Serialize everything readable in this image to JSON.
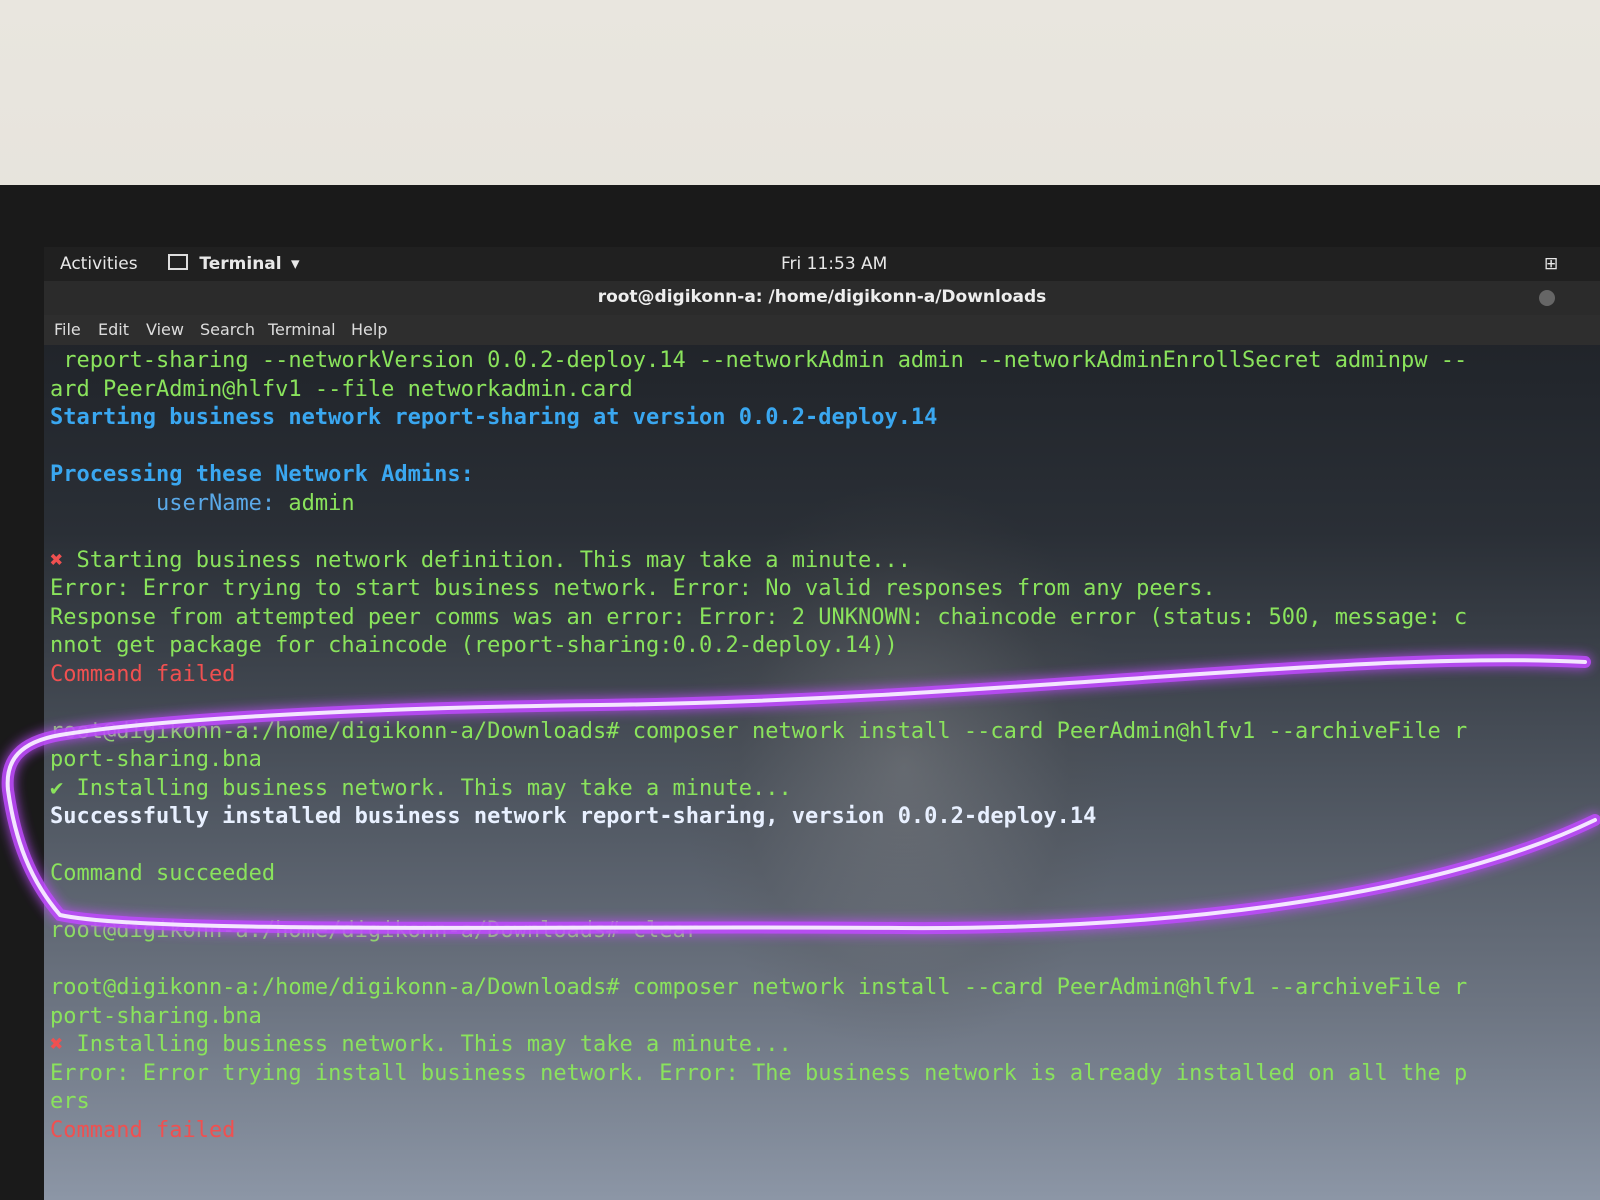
{
  "topbar": {
    "activities": "Activities",
    "app_menu": "Terminal",
    "clock": "Fri 11:53 AM"
  },
  "window": {
    "title": "root@digikonn-a: /home/digikonn-a/Downloads"
  },
  "menu": [
    "File",
    "Edit",
    "View",
    "Search",
    "Terminal",
    "Help"
  ],
  "terminal": {
    "lines": [
      {
        "text": " report-sharing --networkVersion 0.0.2-deploy.14 --networkAdmin admin --networkAdminEnrollSecret adminpw --",
        "cls": "g"
      },
      {
        "text": "ard PeerAdmin@hlfv1 --file networkadmin.card",
        "cls": "g"
      },
      {
        "text": "Starting business network report-sharing at version 0.0.2-deploy.14",
        "cls": "b"
      },
      {
        "text": "",
        "cls": "g"
      },
      {
        "text": "Processing these Network Admins:",
        "cls": "b"
      },
      {
        "text": "        userName: admin",
        "cls": "g",
        "label": "userName:"
      },
      {
        "text": "",
        "cls": "g"
      },
      {
        "text": "✖ Starting business network definition. This may take a minute...",
        "cls": "g",
        "mark": "r"
      },
      {
        "text": "Error: Error trying to start business network. Error: No valid responses from any peers.",
        "cls": "g"
      },
      {
        "text": "Response from attempted peer comms was an error: Error: 2 UNKNOWN: chaincode error (status: 500, message: c",
        "cls": "g"
      },
      {
        "text": "nnot get package for chaincode (report-sharing:0.0.2-deploy.14))",
        "cls": "g"
      },
      {
        "text": "Command failed",
        "cls": "r"
      },
      {
        "text": "",
        "cls": "g"
      },
      {
        "text": "root@digikonn-a:/home/digikonn-a/Downloads# composer network install --card PeerAdmin@hlfv1 --archiveFile r",
        "cls": "g"
      },
      {
        "text": "port-sharing.bna",
        "cls": "g"
      },
      {
        "text": "✔ Installing business network. This may take a minute...",
        "cls": "g"
      },
      {
        "text": "Successfully installed business network report-sharing, version 0.0.2-deploy.14",
        "cls": "w"
      },
      {
        "text": "",
        "cls": "g"
      },
      {
        "text": "Command succeeded",
        "cls": "g"
      },
      {
        "text": "",
        "cls": "g"
      },
      {
        "text": "root@digikonn-a:/home/digikonn-a/Downloads# clear",
        "cls": "g"
      },
      {
        "text": "",
        "cls": "g"
      },
      {
        "text": "root@digikonn-a:/home/digikonn-a/Downloads# composer network install --card PeerAdmin@hlfv1 --archiveFile r",
        "cls": "g"
      },
      {
        "text": "port-sharing.bna",
        "cls": "g"
      },
      {
        "text": "✖ Installing business network. This may take a minute...",
        "cls": "g",
        "mark": "r"
      },
      {
        "text": "Error: Error trying install business network. Error: The business network is already installed on all the p",
        "cls": "g"
      },
      {
        "text": "ers",
        "cls": "g"
      },
      {
        "text": "Command failed",
        "cls": "r"
      }
    ]
  },
  "colors": {
    "prompt_green": "#8ae35c",
    "info_blue": "#3aa7f0",
    "error_red": "#f05050",
    "highlight_purple": "#c04cff"
  }
}
